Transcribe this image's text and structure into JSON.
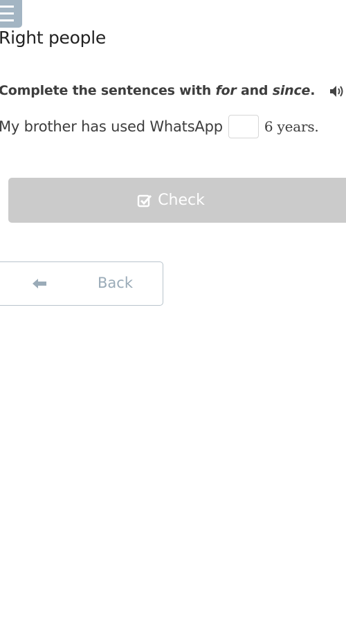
{
  "header": {
    "menu_icon": "hamburger-menu-icon",
    "title": "Right people"
  },
  "exercise": {
    "instruction_prefix": "Complete the sentences with ",
    "instruction_word1": "for",
    "instruction_middle": " and ",
    "instruction_word2": "since",
    "instruction_suffix": ".",
    "audio_icon": "speaker-icon",
    "sentence_before": "My brother has used WhatsApp",
    "gap_value": "",
    "sentence_after": "6 years."
  },
  "buttons": {
    "check_label": "Check",
    "check_icon": "checkbox-checked-icon",
    "back_label": "Back",
    "back_icon": "arrow-left-icon"
  },
  "colors": {
    "menu_bg": "#a3b5c3",
    "check_bg": "#cbcbcb",
    "back_text": "#9aabb8"
  }
}
